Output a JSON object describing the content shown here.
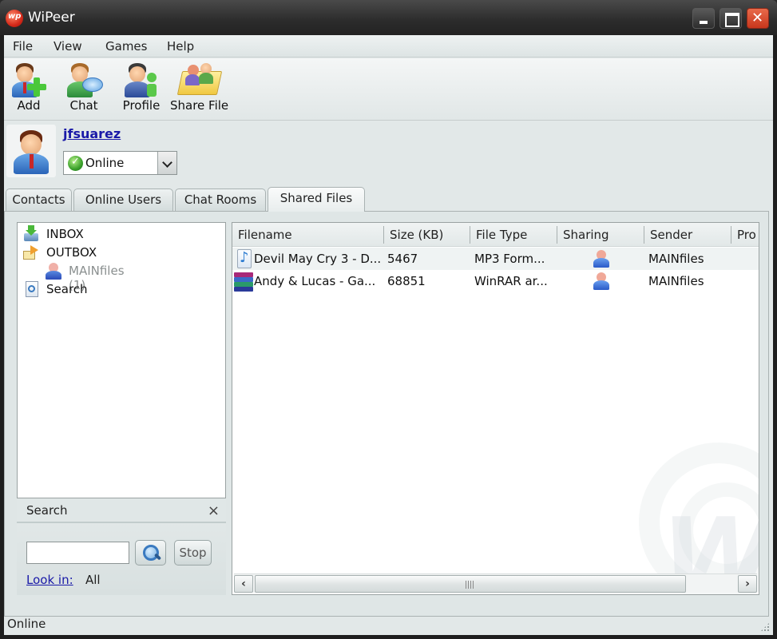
{
  "window": {
    "title": "WiPeer",
    "controls": {
      "minimize": "minimize",
      "maximize": "maximize",
      "close": "close"
    }
  },
  "menu": [
    {
      "label": "File"
    },
    {
      "label": "View"
    },
    {
      "label": "Games"
    },
    {
      "label": "Help"
    }
  ],
  "toolbar": [
    {
      "label": "Add",
      "icon": "add-contact-icon"
    },
    {
      "label": "Chat",
      "icon": "chat-icon"
    },
    {
      "label": "Profile",
      "icon": "profile-icon"
    },
    {
      "label": "Share File",
      "icon": "share-folder-icon"
    }
  ],
  "user": {
    "name": "jfsuarez",
    "status": "Online",
    "status_color": "#3aa02a"
  },
  "tabs": [
    {
      "label": "Contacts",
      "active": false
    },
    {
      "label": "Online Users",
      "active": false
    },
    {
      "label": "Chat Rooms",
      "active": false
    },
    {
      "label": "Shared Files",
      "active": true
    }
  ],
  "tree": [
    {
      "label": "INBOX",
      "icon": "inbox-icon",
      "level": 0
    },
    {
      "label": "OUTBOX",
      "icon": "outbox-icon",
      "level": 0
    },
    {
      "label": "MAINfiles (1)",
      "icon": "user-icon",
      "level": 1
    },
    {
      "label": "Search",
      "icon": "search-doc-icon",
      "level": 0
    }
  ],
  "search_pane": {
    "title": "Search",
    "close": "×",
    "input_value": "",
    "stop_label": "Stop",
    "look_in_label": "Look in:",
    "look_in_value": "All"
  },
  "file_list": {
    "columns": [
      "Filename",
      "Size (KB)",
      "File Type",
      "Sharing",
      "Sender",
      "Pro"
    ],
    "rows": [
      {
        "filename": "Devil May Cry  3 - D...",
        "size": "5467",
        "type": "MP3  Form...",
        "sharing": "user-icon",
        "sender": "MAINfiles",
        "file_icon": "mp3-icon"
      },
      {
        "filename": "Andy & Lucas - Ga...",
        "size": "68851",
        "type": "WinRAR  ar...",
        "sharing": "user-icon",
        "sender": "MAINfiles",
        "file_icon": "winrar-icon"
      }
    ]
  },
  "statusbar": {
    "text": "Online"
  }
}
